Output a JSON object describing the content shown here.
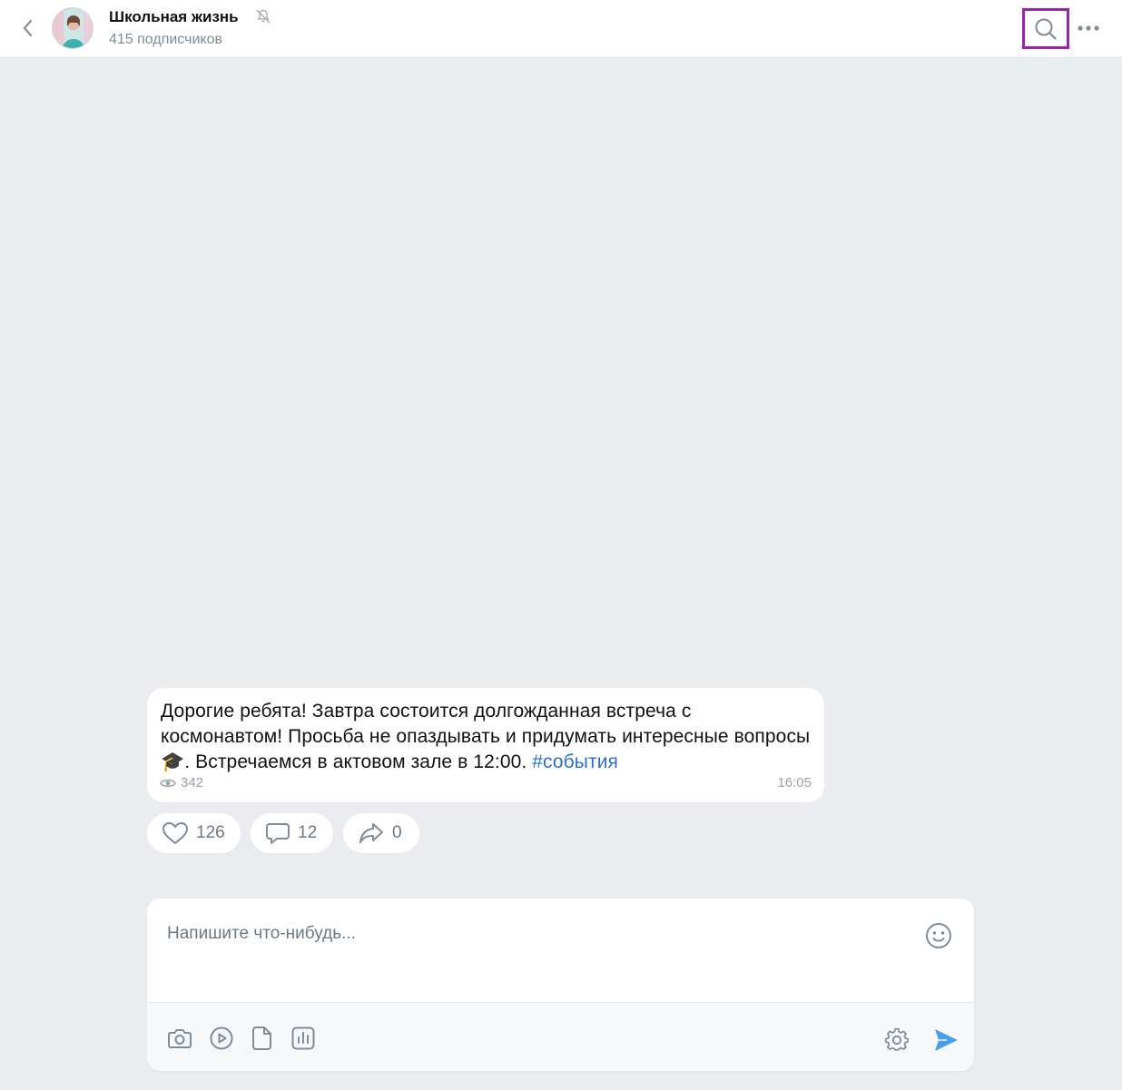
{
  "header": {
    "title": "Школьная жизнь",
    "subtitle": "415 подписчиков",
    "icons": {
      "back": "chevron-left-icon",
      "mute": "bell-muted-icon",
      "search": "search-icon",
      "more": "more-horizontal-icon"
    },
    "highlight_color": "#a020b0"
  },
  "message": {
    "text_before": "Дорогие ребята! Завтра состоится долгожданная встреча с космонавтом! Просьба не опаздывать и придумать интересные вопросы",
    "emoji": "🎓",
    "text_after": ". Встречаемся в актовом зале в 12:00. ",
    "hashtag": "#события",
    "views": "342",
    "time": "16:05"
  },
  "reactions": {
    "likes": "126",
    "comments": "12",
    "shares": "0"
  },
  "composer": {
    "placeholder": "Напишите что-нибудь...",
    "tools": [
      "camera-icon",
      "video-icon",
      "file-icon",
      "poll-icon",
      "gear-icon",
      "send-icon"
    ]
  },
  "colors": {
    "background": "#ebecef",
    "link": "#2f6fc7",
    "send": "#4a9ee8",
    "secondary_text": "#818c99"
  }
}
